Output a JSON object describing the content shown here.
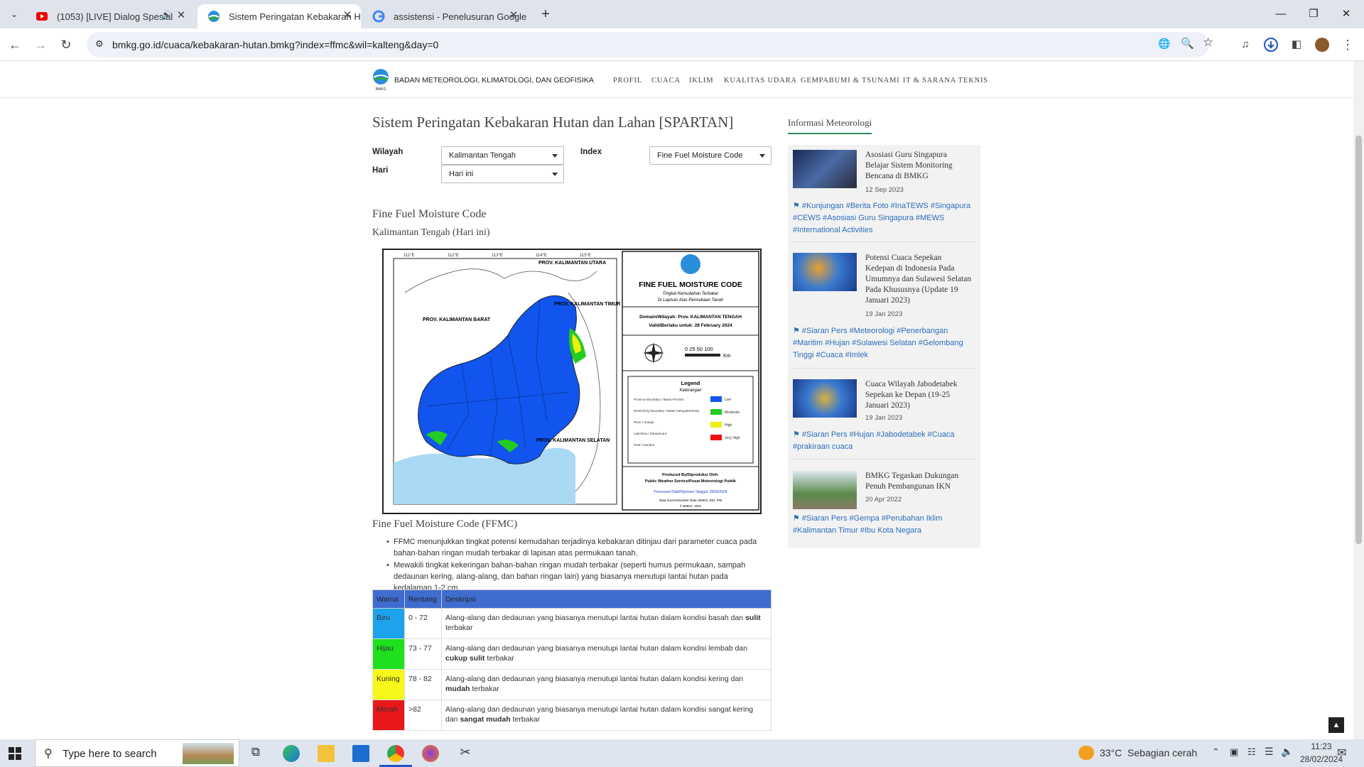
{
  "browser": {
    "tabs": [
      {
        "title": "(1053) [LIVE] Dialog Spesial",
        "active": false
      },
      {
        "title": "Sistem Peringatan Kebakaran H",
        "active": true
      },
      {
        "title": "assistensi - Penelusuran Google",
        "active": false
      }
    ],
    "url": "bmkg.go.id/cuaca/kebakaran-hutan.bmkg?index=ffmc&wil=kalteng&day=0"
  },
  "site": {
    "brand": "BADAN METEOROLOGI, KLIMATOLOGI, DAN GEOFISIKA",
    "nav": [
      "PROFIL",
      "CUACA",
      "IKLIM",
      "KUALITAS UDARA",
      "GEMPABUMI & TSUNAMI",
      "IT & SARANA TEKNIS"
    ]
  },
  "main": {
    "title": "Sistem Peringatan Kebakaran Hutan dan Lahan [SPARTAN]",
    "wilayah_label": "Wilayah",
    "wilayah_value": "Kalimantan Tengah",
    "index_label": "Index",
    "index_value": "Fine Fuel Moisture Code",
    "hari_label": "Hari",
    "hari_value": "Hari ini",
    "map_heading": "Fine Fuel Moisture Code",
    "map_subheading": "Kalimantan Tengah (Hari ini)",
    "section_heading": "Fine Fuel Moisture Code (FFMC)",
    "bullets": [
      "FFMC menunjukkan tingkat potensi kemudahan terjadinya kebakaran ditinjau dari parameter cuaca pada bahan-bahan ringan mudah terbakar di lapisan atas permukaan tanah.",
      "Mewakili tingkat kekeringan bahan-bahan ringan mudah terbakar (seperti humus permukaan, sampah dedaunan kering, alang-alang, dan bahan ringan lain) yang biasanya menutupi lantai hutan pada kedalaman 1-2 cm."
    ],
    "table": {
      "headers": [
        "Warna",
        "Rentang",
        "Deskripsi"
      ],
      "rows": [
        {
          "warna": "Biru",
          "color": "#1ca3ec",
          "rentang": "0 - 72",
          "pre": "Alang-alang dan dedaunan yang biasanya menutupi lantai hutan dalam kondisi basah dan ",
          "bold": "sulit",
          "post": " terbakar"
        },
        {
          "warna": "Hijau",
          "color": "#1ee01e",
          "rentang": "73 - 77",
          "pre": "Alang-alang dan dedaunan yang biasanya menutupi lantai hutan dalam kondisi lembab dan ",
          "bold": "cukup sulit",
          "post": " terbakar"
        },
        {
          "warna": "Kuning",
          "color": "#f7f71a",
          "rentang": "78 - 82",
          "pre": "Alang-alang dan dedaunan yang biasanya menutupi lantai hutan dalam kondisi kering dan ",
          "bold": "mudah",
          "post": " terbakar"
        },
        {
          "warna": "Merah",
          "color": "#e8181a",
          "rentang": ">82",
          "pre": "Alang-alang dan dedaunan yang biasanya menutupi lantai hutan dalam kondisi sangat kering dan ",
          "bold": "sangat mudah",
          "post": " terbakar"
        }
      ]
    }
  },
  "map": {
    "title": "FINE FUEL MOISTURE CODE",
    "subtitle1": "Tingkat Kemudahan Terbakar",
    "subtitle2": "Di Lapisan Atas Permukaan Tanah",
    "domain": "Domain/Wilayah: Prov. KALIMANTAN TENGAH",
    "valid": "Valid/Berlaku untuk: 28 February 2024",
    "scale_label": "0  25 50      100",
    "scale_unit": "Km",
    "legend_title": "Legend",
    "legend_subtitle": "Keterangan",
    "legend_items": [
      {
        "label": "Low",
        "sub": "Aman",
        "color": "#1155ee"
      },
      {
        "label": "Moderate",
        "sub": "Tidak Mudah",
        "color": "#22cc22"
      },
      {
        "label": "High",
        "sub": "Mudah",
        "color": "#eeee11"
      },
      {
        "label": "Very High",
        "sub": "Sangat Mudah",
        "color": "#ee1111"
      }
    ],
    "legend_lines": [
      "Province Boundary / Batas Provinsi",
      "District/City Boundary / Batas Kabupaten/Kota",
      "River / Sungai",
      "Lake/Sea / Danau/Laut",
      "Peat / Gambut"
    ],
    "produced": "Produced By/Diproduksi Oleh:",
    "producer": "Public Weather Service/Pusat Meteorologi Publik",
    "processed": "Processed Date/Diproses Tanggal: 28/02/2024",
    "source": "Data Source/Sumber Data: BMKG, BIG, IPB",
    "copyright": "© BMKG, 2024",
    "labels": [
      "PROV. KALIMANTAN BARAT",
      "PROV. KALIMANTAN TIMUR",
      "PROV. KALIMANTAN SELATAN",
      "PROV. KALIMANTAN UTARA"
    ],
    "lon_ticks": [
      "111°E",
      "112°E",
      "113°E",
      "114°E",
      "115°E"
    ]
  },
  "sidebar": {
    "title": "Informasi Meteorologi",
    "news": [
      {
        "title": "Asosiasi Guru Singapura Belajar Sistem Monitoring Bencana di BMKG",
        "date": "12 Sep 2023",
        "tags": "#Kunjungan #Berita Foto #InaTEWS #Singapura #CEWS #Asosiasi Guru Singapura #MEWS #International Activities"
      },
      {
        "title": "Potensi Cuaca Sepekan Kedepan di Indonesia Pada Umumnya dan Sulawesi Selatan Pada Khususnya (Update 19 Januari 2023)",
        "date": "19 Jan 2023",
        "tags": "#Siaran Pers #Meteorologi #Penerbangan #Maritim #Hujan #Sulawesi Selatan #Gelombang Tinggi #Cuaca #Imlek"
      },
      {
        "title": "Cuaca Wilayah Jabodetabek Sepekan ke Depan (19-25 Januari 2023)",
        "date": "19 Jan 2023",
        "tags": "#Siaran Pers #Hujan #Jabodetabek #Cuaca #prakiraan cuaca"
      },
      {
        "title": "BMKG Tegaskan Dukungan Penuh Pembangunan IKN",
        "date": "20 Apr 2022",
        "tags": "#Siaran Pers #Gempa #Perubahan Iklim #Kalimantan Timur #Ibu Kota Negara"
      }
    ]
  },
  "taskbar": {
    "search_placeholder": "Type here to search",
    "weather": "33°C  Sebagian cerah",
    "time": "11:23",
    "date": "28/02/2024"
  }
}
